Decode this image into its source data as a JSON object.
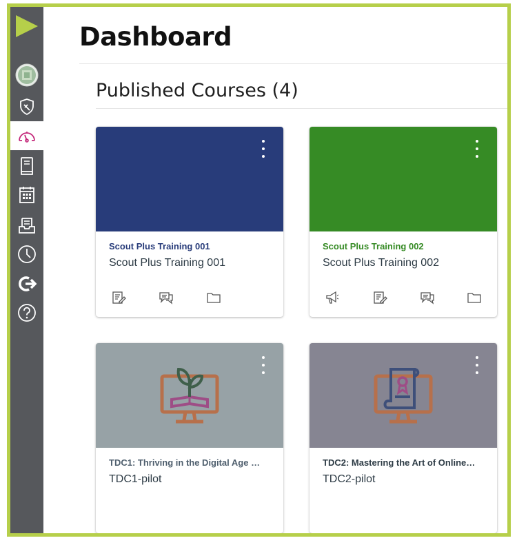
{
  "page": {
    "title": "Dashboard",
    "section_title": "Published Courses (4)"
  },
  "nav": {
    "items": [
      {
        "name": "logo",
        "icon": "play-logo-icon"
      },
      {
        "name": "account",
        "icon": "avatar"
      },
      {
        "name": "admin",
        "icon": "shield-icon"
      },
      {
        "name": "dashboard",
        "icon": "speedometer-icon",
        "active": true
      },
      {
        "name": "courses",
        "icon": "book-icon"
      },
      {
        "name": "calendar",
        "icon": "calendar-icon"
      },
      {
        "name": "inbox",
        "icon": "inbox-icon"
      },
      {
        "name": "history",
        "icon": "clock-icon"
      },
      {
        "name": "commons",
        "icon": "share-arrow-icon"
      },
      {
        "name": "help",
        "icon": "question-icon"
      }
    ]
  },
  "colors": {
    "frame_border": "#b6cf4a",
    "nav_bg": "#56585c",
    "nav_active_icon": "#c4287a",
    "card1_hero": "#283c7a",
    "card1_code": "#283c7a",
    "card2_hero": "#368b25",
    "card2_code": "#368b25",
    "card3_hero": "#97a2a6",
    "card3_code": "#4e5e6d",
    "card4_hero": "#868592",
    "card4_code": "#2d3b45"
  },
  "cards": [
    {
      "code": "Scout Plus Training 001",
      "term": "Scout Plus Training 001",
      "icons": [
        "assignments-icon",
        "discussions-icon",
        "files-icon"
      ]
    },
    {
      "code": "Scout Plus Training 002",
      "term": "Scout Plus Training 002",
      "icons": [
        "announcements-icon",
        "assignments-icon",
        "discussions-icon",
        "files-icon"
      ]
    },
    {
      "code": "TDC1: Thriving in the Digital Age …",
      "term": "TDC1-pilot",
      "icons": []
    },
    {
      "code": "TDC2: Mastering the Art of Online…",
      "term": "TDC2-pilot",
      "icons": []
    }
  ]
}
